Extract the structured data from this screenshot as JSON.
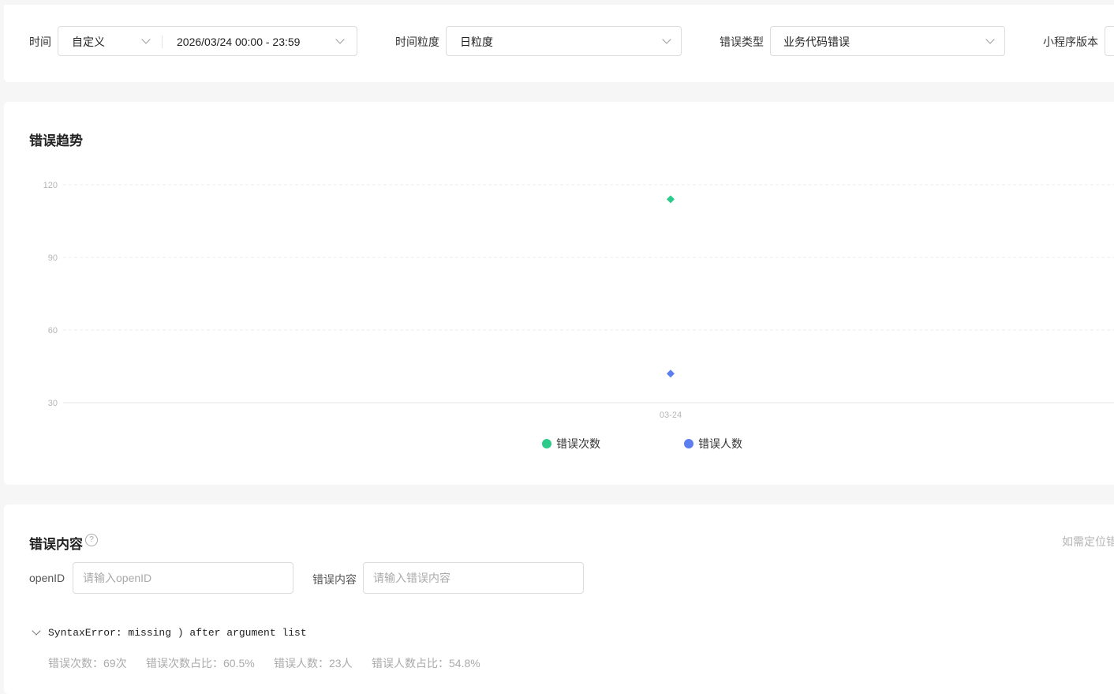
{
  "filters": {
    "time_label": "时间",
    "time_mode": "自定义",
    "date_range": "2026/03/24 00:00 - 23:59",
    "granularity_label": "时间粒度",
    "granularity_value": "日粒度",
    "error_type_label": "错误类型",
    "error_type_value": "业务代码错误",
    "version_label": "小程序版本"
  },
  "trend": {
    "title": "错误趋势"
  },
  "chart_data": {
    "type": "scatter",
    "categories": [
      "03-24"
    ],
    "series": [
      {
        "name": "错误次数",
        "values": [
          114
        ],
        "color": "#2ccb8a",
        "marker": "diamond"
      },
      {
        "name": "错误人数",
        "values": [
          42
        ],
        "color": "#5b7ef0",
        "marker": "diamond"
      }
    ],
    "ylim": [
      30,
      120
    ],
    "yticks": [
      30,
      60,
      90,
      120
    ],
    "grid": true,
    "legend_position": "bottom"
  },
  "errors": {
    "title": "错误内容",
    "help_icon": "?",
    "hint": "如需定位错",
    "openid_label": "openID",
    "openid_placeholder": "请输入openID",
    "content_label": "错误内容",
    "content_placeholder": "请输入错误内容",
    "item_title": "SyntaxError: missing ) after argument list",
    "stats": {
      "count": "错误次数：69次",
      "count_ratio": "错误次数占比：60.5%",
      "users": "错误人数：23人",
      "users_ratio": "错误人数占比：54.8%"
    }
  }
}
